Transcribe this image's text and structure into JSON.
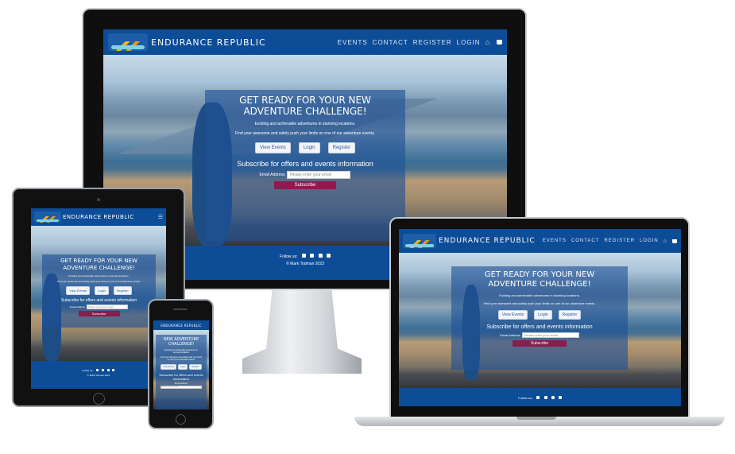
{
  "site": {
    "brand": "ENDURANCE REPUBLIC",
    "nav": [
      "EVENTS",
      "CONTACT",
      "REGISTER",
      "LOGIN"
    ],
    "home_glyph": "⌂",
    "cart_glyph": "🛒",
    "menu_glyph": "☰",
    "hero_title": "GET READY FOR YOUR NEW ADVENTURE CHALLENGE!",
    "hero_title_phone_partial": "NEW ADVENTURE CHALLENGE!",
    "hero_line1": "Exciting and achievable adventures in stunning locations.",
    "hero_line2": "Find your awesome and safely push your limits on one of our adventure events.",
    "buttons": [
      "View Events",
      "Login",
      "Register"
    ],
    "subscribe_heading": "Subscribe for offers and events information",
    "email_label": "Email Address",
    "email_placeholder": "Please enter your email",
    "subscribe_button": "Subscribe",
    "follow_us": "Follow us:",
    "copyright": "© Mark Todman 2023"
  },
  "colors": {
    "nav_blue": "#0d4c97",
    "hero_overlay": "#1e5096",
    "subscribe_magenta": "#8b1c4e",
    "device_black": "#111111"
  }
}
